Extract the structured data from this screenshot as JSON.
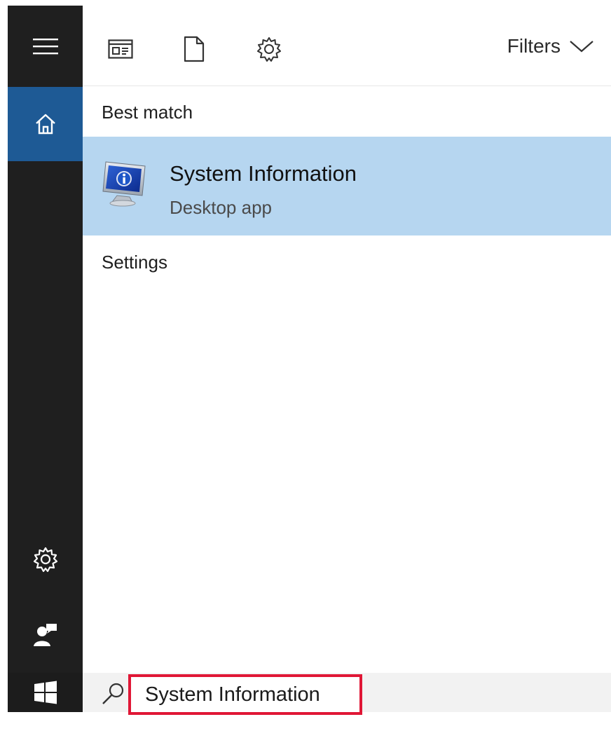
{
  "toolbar": {
    "filters_label": "Filters"
  },
  "results": {
    "best_match_label": "Best match",
    "best_match": {
      "title": "System Information",
      "subtitle": "Desktop app"
    },
    "settings_label": "Settings"
  },
  "search": {
    "value": "System Information"
  },
  "colors": {
    "rail": "#1f1f1f",
    "home_active": "#1e5a95",
    "highlight": "#b6d6f0",
    "search_outline": "#e01736"
  }
}
